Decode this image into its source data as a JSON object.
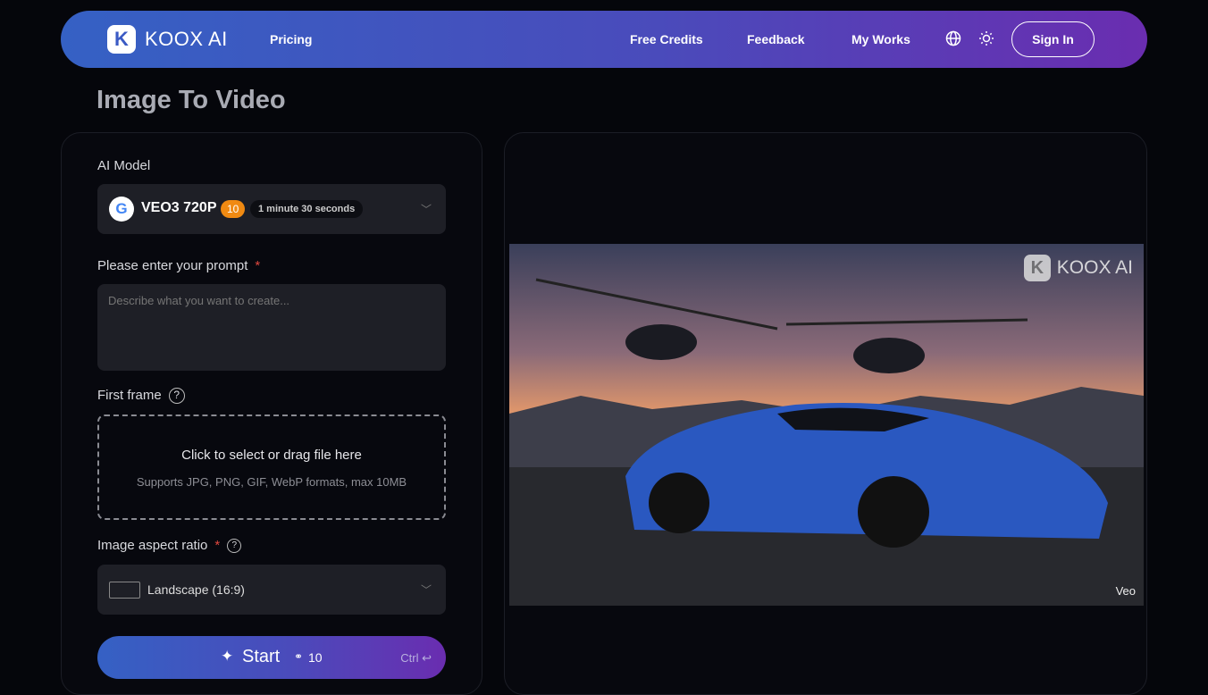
{
  "nav": {
    "brand": "KOOX AI",
    "logo_letter": "K",
    "pricing": "Pricing",
    "free_credits": "Free Credits",
    "feedback": "Feedback",
    "my_works": "My Works",
    "sign_in": "Sign In"
  },
  "page_title": "Image To Video",
  "form": {
    "model_label": "AI Model",
    "model_name": "VEO3 720P",
    "model_credits": "10",
    "model_duration": "1 minute 30 seconds",
    "prompt_label": "Please enter your prompt",
    "required_mark": "*",
    "prompt_placeholder": "Describe what you want to create...",
    "prompt_value": "",
    "first_frame_label": "First frame",
    "upload_title": "Click to select or drag file here",
    "upload_hint": "Supports JPG, PNG, GIF, WebP formats, max 10MB",
    "aspect_label": "Image aspect ratio",
    "aspect_value": "Landscape (16:9)",
    "start_label": "Start",
    "start_cost": "10",
    "shortcut": "Ctrl ↩"
  },
  "preview": {
    "watermark": "KOOX AI",
    "watermark_letter": "K",
    "source_tag": "Veo"
  }
}
